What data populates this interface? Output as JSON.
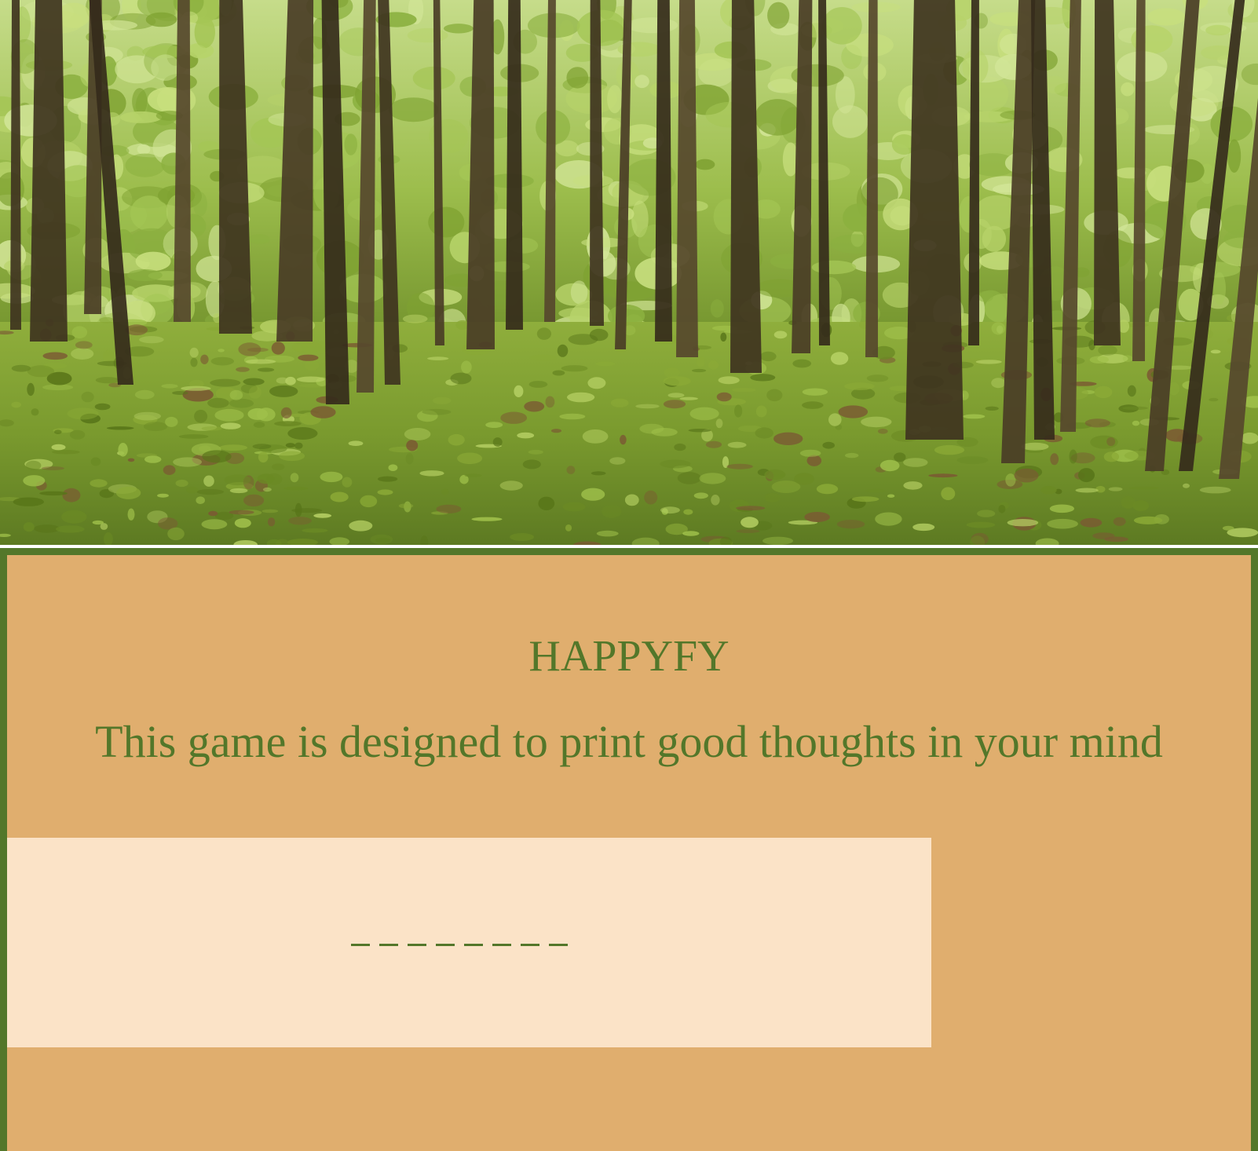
{
  "hero": {
    "icon": "forest-photo"
  },
  "game": {
    "title": "HAPPYFY",
    "description": "This game is designed to print good thoughts in your mind",
    "word": {
      "blank_count": 8
    }
  },
  "colors": {
    "accent_green": "#53772a",
    "panel_background": "#e0ae6e",
    "word_box_background": "#fbe3c7"
  }
}
